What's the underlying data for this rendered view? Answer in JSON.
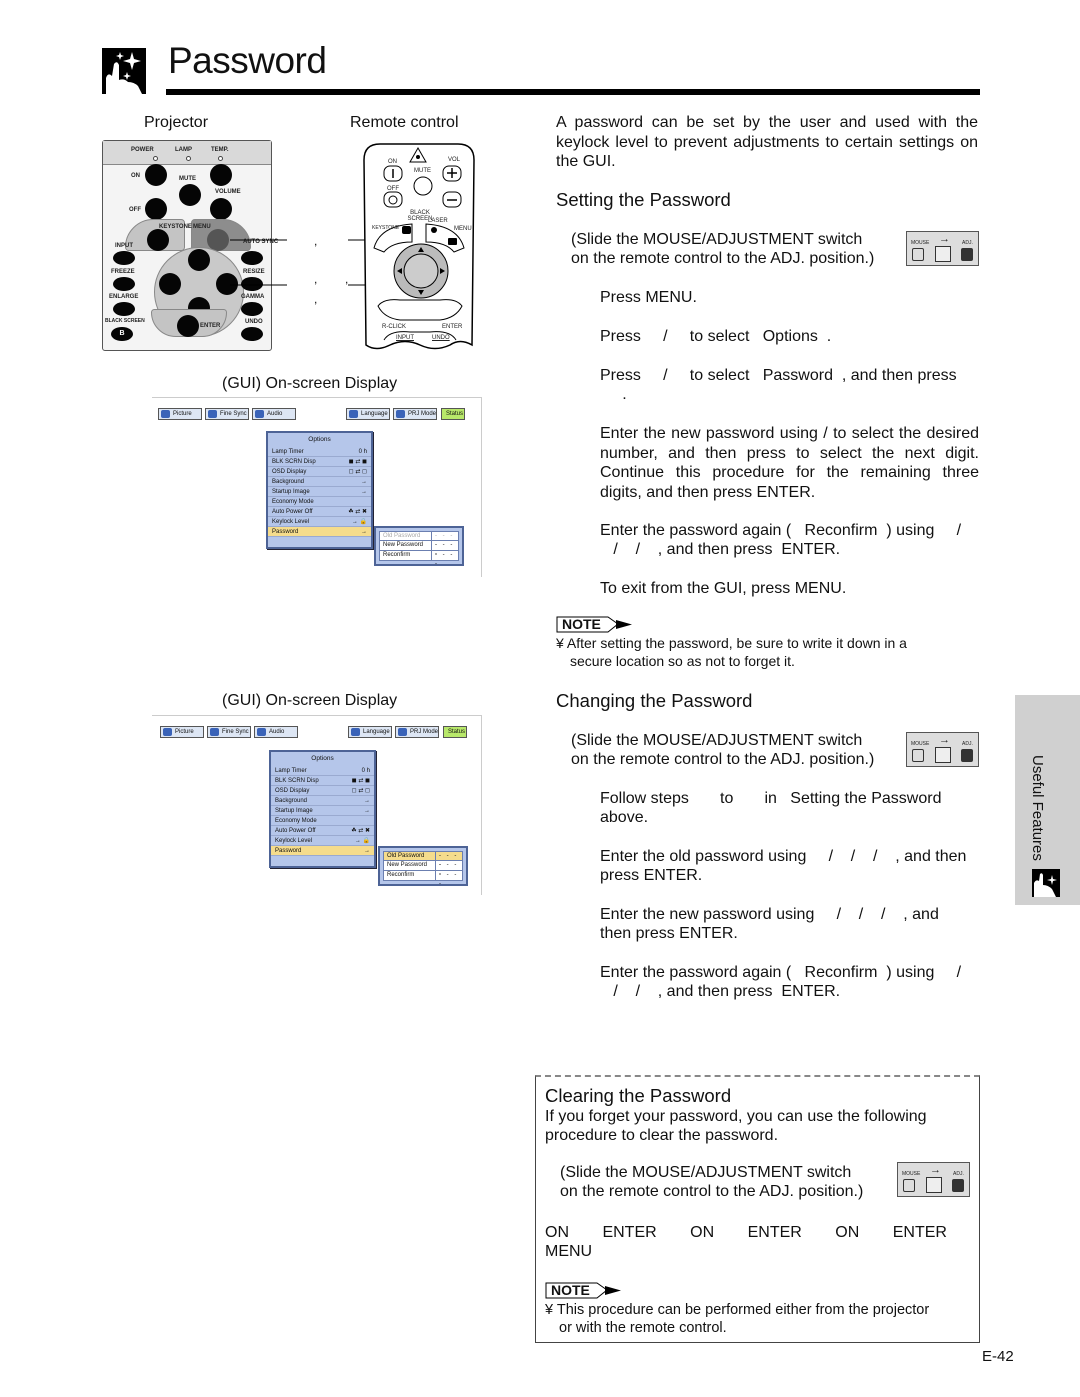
{
  "header": {
    "title": "Password",
    "icon": "sparkle-hand-icon"
  },
  "left": {
    "projector_label": "Projector",
    "remote_label": "Remote control",
    "projector_panel": {
      "indicators": [
        "POWER",
        "LAMP",
        "TEMP."
      ],
      "buttons": [
        "ON",
        "MUTE",
        "VOLUME",
        "OFF",
        "KEYSTONE",
        "MENU",
        "INPUT",
        "AUTO SYNC",
        "FREEZE",
        "RESIZE",
        "ENLARGE",
        "GAMMA",
        "BLACK SCREEN",
        "ENTER",
        "UNDO"
      ],
      "black_screen_glyph": "B"
    },
    "remote_panel": {
      "buttons": [
        "ON",
        "MUTE",
        "VOL",
        "OFF",
        "BLACK SCREEN",
        "LASER",
        "KEYSTONE",
        "MENU",
        "R-CLICK",
        "ENTER",
        "INPUT",
        "UNDO"
      ]
    },
    "callout_separators": [
      ",",
      ",",
      ",",
      ","
    ],
    "gui_caption_1": "(GUI) On-screen Display",
    "gui_caption_2": "(GUI) On-screen Display"
  },
  "gui": {
    "tabs": [
      "Picture",
      "Fine Sync",
      "Audio",
      "Language",
      "PRJ Mode",
      "Status"
    ],
    "menu_title": "Options",
    "rows": [
      {
        "label": "Lamp Timer",
        "value": "0 h"
      },
      {
        "label": "BLK SCRN Disp",
        "value": "◼ ⇄ ◼"
      },
      {
        "label": "OSD Display",
        "value": "◻ ⇄ ◻"
      },
      {
        "label": "Background",
        "value": "→"
      },
      {
        "label": "Startup Image",
        "value": "→"
      },
      {
        "label": "Economy Mode",
        "value": ""
      },
      {
        "label": "Auto Power Off",
        "value": "☘ ⇄ ✖"
      },
      {
        "label": "Keylock Level",
        "value": "→ 🔒"
      },
      {
        "label": "Password",
        "value": "→"
      }
    ],
    "sub_rows": [
      {
        "label": "Old Password",
        "value": "- - - -"
      },
      {
        "label": "New Password",
        "value": "- - - -"
      },
      {
        "label": "Reconfirm",
        "value": "- - - -"
      }
    ]
  },
  "intro": "A password can be set by the user and used with the keylock level to prevent adjustments to certain settings on the GUI.",
  "setting": {
    "heading": "Setting the Password",
    "switch_note_1": "(Slide the MOUSE/ADJUSTMENT  switch",
    "switch_note_2": "on the remote control to the ADJ. position.)",
    "steps": [
      "Press MENU.",
      "Press     /     to select   Options  .",
      "Press     /     to select   Password  , and then press",
      "     .",
      "Enter the new password using     /     to select the desired number, and then press       to select the next digit. Continue this procedure for the remaining three digits, and then press  ENTER.",
      "Enter the password again (   Reconfirm  ) using     /",
      "   /    /    , and then press  ENTER.",
      "To exit from the GUI, press MENU."
    ],
    "note_label": "NOTE",
    "note": "¥ After setting the password, be sure to write it down in a",
    "note_cont": "secure location so as not to forget it."
  },
  "changing": {
    "heading": "Changing the Password",
    "switch_note_1": "(Slide the MOUSE/ADJUSTMENT  switch",
    "switch_note_2": "on the remote control to the ADJ. position.)",
    "steps": [
      "Follow steps       to       in   Setting the Password",
      "above.",
      "Enter the old password using     /    /    /    , and then",
      "press  ENTER.",
      "Enter the new password using     /    /    /    , and",
      "then press  ENTER.",
      "Enter the password again (   Reconfirm  ) using     /",
      "   /    /    , and then press  ENTER."
    ]
  },
  "clearing": {
    "heading": "Clearing the Password",
    "desc_1": "If you forget your password, you can use the following",
    "desc_2": "procedure to clear the password.",
    "switch_note_1": "(Slide the MOUSE/ADJUSTMENT  switch",
    "switch_note_2": "on the remote control to the ADJ. position.)",
    "sequence": [
      "ON",
      "ENTER",
      "ON",
      "ENTER",
      "ON",
      "ENTER"
    ],
    "sequence_end": "MENU",
    "note_label": "NOTE",
    "note": "¥ This procedure can be performed either from the projector",
    "note_cont": "or with the remote control."
  },
  "switch_graphic": {
    "left_label": "MOUSE",
    "right_label": "ADJ.",
    "arrow": "→"
  },
  "side_tab": {
    "label": "Useful Features",
    "icon": "sparkle-hand-icon"
  },
  "page_number": "E-42"
}
